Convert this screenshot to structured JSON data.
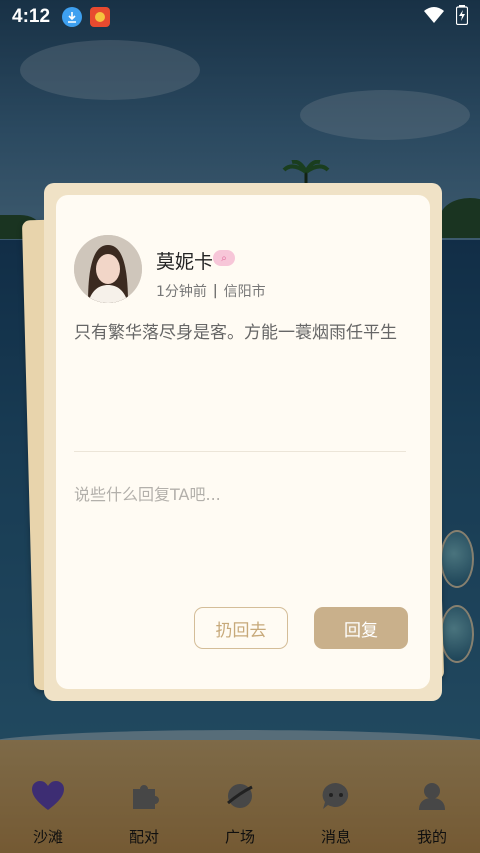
{
  "status_bar": {
    "time": "4:12"
  },
  "post": {
    "author_name": "莫妮卡",
    "time_ago": "1分钟前",
    "separator": "|",
    "location": "信阳市",
    "content": "只有繁华落尽身是客。方能一蓑烟雨任平生"
  },
  "reply": {
    "placeholder": "说些什么回复TA吧...",
    "value": ""
  },
  "actions": {
    "throw_back_label": "扔回去",
    "reply_label": "回复"
  },
  "bottom_nav": {
    "items": [
      {
        "label": "沙滩",
        "icon": "heart-icon",
        "active": true
      },
      {
        "label": "配对",
        "icon": "puzzle-icon",
        "active": false
      },
      {
        "label": "广场",
        "icon": "planet-icon",
        "active": false
      },
      {
        "label": "消息",
        "icon": "chat-icon",
        "active": false
      },
      {
        "label": "我的",
        "icon": "profile-icon",
        "active": false
      }
    ]
  },
  "colors": {
    "accent": "#c9b08b",
    "active_nav": "#6a4fc7",
    "badge": "#f7c6d8"
  }
}
